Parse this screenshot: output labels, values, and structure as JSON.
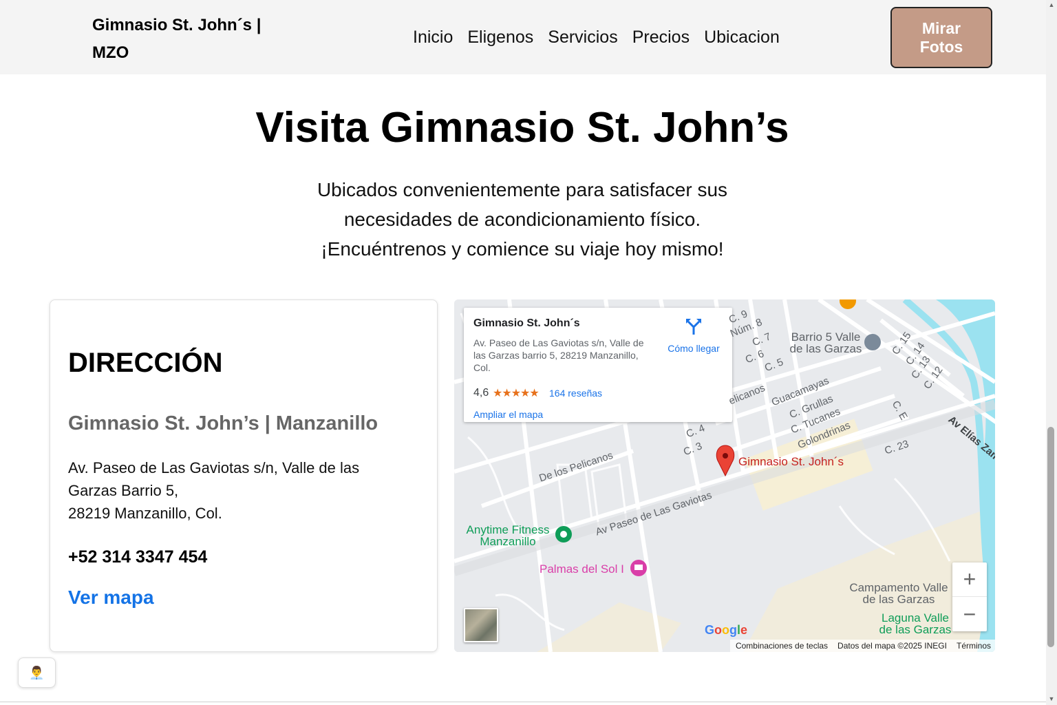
{
  "header": {
    "brand": "Gimnasio St. John´s | MZO",
    "nav": [
      "Inicio",
      "Eligenos",
      "Servicios",
      "Precios",
      "Ubicacion"
    ],
    "cta": "Mirar Fotos"
  },
  "hero": {
    "title": "Visita Gimnasio St. John’s",
    "subtitle": "Ubicados convenientemente para satisfacer sus necesidades de acondicionamiento físico. ¡Encuéntrenos y comience su viaje hoy mismo!"
  },
  "address": {
    "heading": "DIRECCIÓN",
    "name": "Gimnasio St. John’s | Manzanillo",
    "line1": "Av. Paseo de Las Gaviotas s/n, Valle de las Garzas Barrio 5,",
    "line2": "28219 Manzanillo, Col.",
    "phone": "+52 314 3347 454",
    "map_link": "Ver mapa"
  },
  "map": {
    "infobox": {
      "title": "Gimnasio St. John´s",
      "address": "Av. Paseo de Las Gaviotas s/n, Valle de las Garzas barrio 5, 28219 Manzanillo, Col.",
      "rating": "4,6",
      "stars": "★★★★★",
      "reviews": "164 reseñas",
      "expand": "Ampliar el mapa",
      "directions": "Cómo llegar"
    },
    "pin_label": "Gimnasio St. John´s",
    "pois": {
      "anytime": "Anytime Fitness Manzanillo",
      "palmas": "Palmas del Sol I",
      "barrio": "Barrio 5 Valle de las Garzas",
      "campamento": "Campamento Valle de las Garzas",
      "laguna": "Laguna Valle de las Garzas"
    },
    "streets": {
      "gaviotas": "Av Paseo de Las Gaviotas",
      "pelicanos": "De los Pelicanos",
      "pelicanos2": "elicanos",
      "guacamayas": "Guacamayas",
      "grullas": "C. Grullas",
      "tucanes": "C. Tucanes",
      "golondrinas": "Golondrinas",
      "c3": "C. 3",
      "c4": "C. 4",
      "c5": "C. 5",
      "c6": "C. 6",
      "c7": "C. 7",
      "num8": "Núm. 8",
      "c9": "C. 9",
      "c12": "C. 12",
      "c13": "C. 13",
      "c14": "C. 14",
      "c15": "C. 15",
      "c23": "C. 23",
      "ce": "C. E",
      "elias": "Av Elías Zam"
    },
    "zoom_in": "+",
    "zoom_out": "−",
    "logo": "Google",
    "attribution": [
      "Combinaciones de teclas",
      "Datos del mapa ©2025 INEGI",
      "Términos"
    ],
    "colors": {
      "pin": "#ea4335",
      "water": "#9be2f0",
      "road": "#ffffff",
      "land": "#e8eaed",
      "poi_green": "#0f9d58",
      "poi_pink": "#d93ea8"
    }
  },
  "colors": {
    "cta_bg": "#c49b87",
    "link": "#1473e6",
    "header_bg": "#f4f4f4"
  }
}
